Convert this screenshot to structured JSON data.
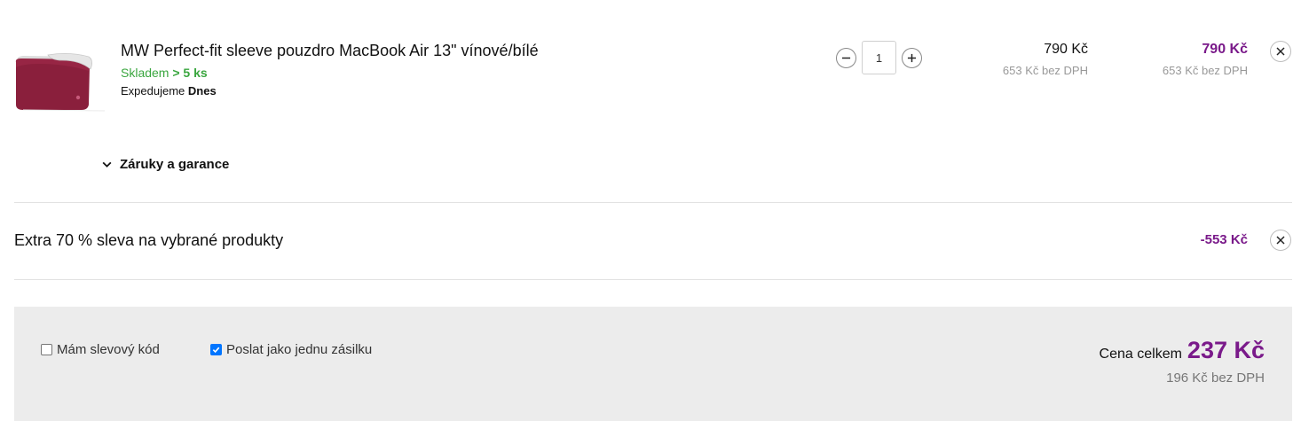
{
  "product": {
    "name": "MW Perfect-fit sleeve pouzdro MacBook Air 13\" vínové/bílé",
    "stock_label": "Skladem",
    "stock_count": "> 5 ks",
    "shipping_label": "Expedujeme",
    "shipping_day": "Dnes",
    "quantity": "1",
    "unit_price": "790 Kč",
    "unit_price_net": "653 Kč bez DPH",
    "total_price": "790 Kč",
    "total_price_net": "653 Kč bez DPH",
    "image_icon": "laptop-sleeve-image"
  },
  "warranty": {
    "label": "Záruky a garance"
  },
  "discount": {
    "label": "Extra 70 % sleva na vybrané produkty",
    "value": "-553 Kč"
  },
  "summary": {
    "coupon_label": "Mám slevový kód",
    "coupon_checked": false,
    "single_shipment_label": "Poslat jako jednu zásilku",
    "single_shipment_checked": true,
    "total_label": "Cena celkem",
    "total_value": "237 Kč",
    "total_net": "196 Kč bez DPH"
  },
  "colors": {
    "accent": "#7a1a8a",
    "in_stock": "#3aa63f",
    "summary_bg": "#ececec",
    "checkbox": "#0075ff"
  }
}
